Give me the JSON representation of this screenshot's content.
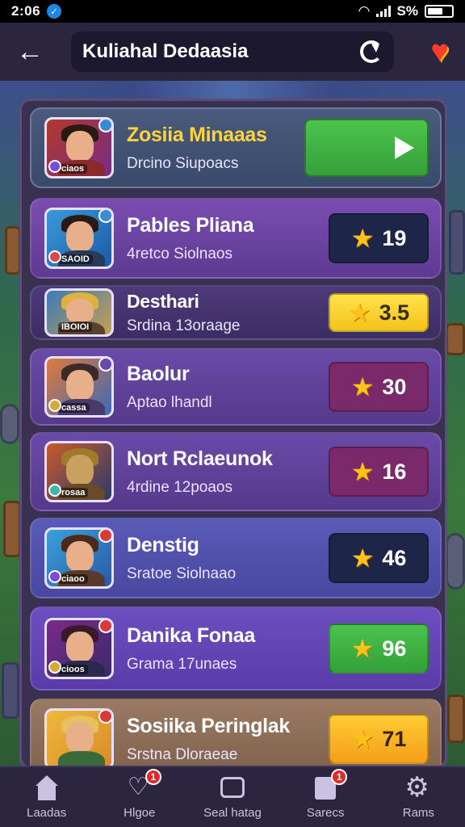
{
  "status_bar": {
    "time": "2:06",
    "signal_text": "S%"
  },
  "header": {
    "search_value": "Kuliahal Dedaasia",
    "back_icon": "arrow-left-icon",
    "refresh_icon": "refresh-icon",
    "favorite_icon": "heart-icon"
  },
  "list": [
    {
      "name": "Zosiia Minaaas",
      "sub": "Drcino Siupoacs",
      "tag": "ciaos",
      "action": "play",
      "accent": "#ffd33a"
    },
    {
      "name": "Pables Pliana",
      "sub": "4retco Siolnaos",
      "tag": "SAOID",
      "score": "19",
      "score_style": "navy"
    },
    {
      "name": "Desthari",
      "sub": "Srdina 13oraage",
      "tag": "IBOIOI",
      "score": "3.5",
      "score_style": "yellow"
    },
    {
      "name": "Baolur",
      "sub": "Aptao lhandl",
      "tag": "cassa",
      "score": "30",
      "score_style": "plum"
    },
    {
      "name": "Nort Rclaeunok",
      "sub": "4rdine 12poaos",
      "tag": "rosaa",
      "score": "16",
      "score_style": "plum"
    },
    {
      "name": "Denstig",
      "sub": "Sratoe Siolnaao",
      "tag": "ciaoo",
      "score": "46",
      "score_style": "navy"
    },
    {
      "name": "Danika Fonaa",
      "sub": "Grama 17unaes",
      "tag": "cioos",
      "score": "96",
      "score_style": "green"
    },
    {
      "name": "Sosiika Peringlak",
      "sub": "Srstna Dloraeae",
      "tag": "",
      "score": "71",
      "score_style": "orange"
    }
  ],
  "bottom_nav": [
    {
      "label": "Laadas",
      "icon": "home-icon",
      "badge": ""
    },
    {
      "label": "Hlgoe",
      "icon": "heart-icon",
      "badge": "1"
    },
    {
      "label": "Seal hatag",
      "icon": "chat-icon",
      "badge": ""
    },
    {
      "label": "Sarecs",
      "icon": "cards-icon",
      "badge": "1"
    },
    {
      "label": "Rams",
      "icon": "gear-icon",
      "badge": ""
    }
  ]
}
